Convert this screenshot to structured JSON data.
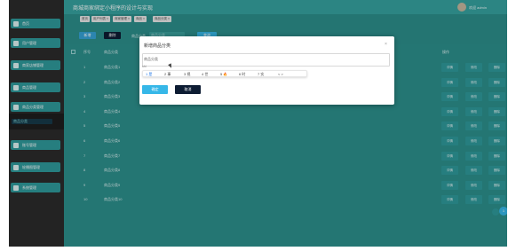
{
  "app": {
    "title": "商城商家绑定小程序的设计与实现",
    "user": "欢迎 admin",
    "colors": {
      "sidebar": "#2b2b2b",
      "main": "#2c8f8c",
      "accent": "#36b7e8",
      "button_dark": "#0d1c33"
    }
  },
  "tabs": [
    {
      "label": "首页"
    },
    {
      "label": "用户列表 ×"
    },
    {
      "label": "商家管理 ×"
    },
    {
      "label": "商品 ×"
    },
    {
      "label": "商品分类 ×"
    }
  ],
  "sidebar": {
    "items": [
      {
        "label": "首页"
      },
      {
        "label": "用户管理"
      },
      {
        "label": "商家店铺管理"
      },
      {
        "label": "商品管理"
      },
      {
        "label": "商品分类管理"
      },
      {
        "label": "账号管理"
      },
      {
        "label": "轮播图管理"
      },
      {
        "label": "系统管理"
      }
    ],
    "sub_item": "商品分类"
  },
  "toolbar": {
    "add_label": "新增",
    "delete_label": "删除",
    "filter_label": "商品分类",
    "filter_placeholder": "商品分类",
    "search_label": "查询"
  },
  "table": {
    "headers": [
      "序号",
      "商品分类",
      "操作"
    ],
    "rows": [
      {
        "num": "1",
        "name": "商品分类1"
      },
      {
        "num": "2",
        "name": "商品分类2"
      },
      {
        "num": "3",
        "name": "商品分类3"
      },
      {
        "num": "4",
        "name": "商品分类4"
      },
      {
        "num": "5",
        "name": "商品分类5"
      },
      {
        "num": "6",
        "name": "商品分类6"
      },
      {
        "num": "7",
        "name": "商品分类7"
      },
      {
        "num": "8",
        "name": "商品分类8"
      },
      {
        "num": "9",
        "name": "商品分类9"
      },
      {
        "num": "10",
        "name": "商品分类10"
      }
    ],
    "actions": [
      "详情",
      "修改",
      "删除"
    ]
  },
  "pager": {
    "current": "1"
  },
  "dialog": {
    "title": "新增商品分类",
    "close": "×",
    "field_label": "商品分类",
    "field_value": "商品分类",
    "hint": "shi",
    "candidates": [
      {
        "label": "1 是",
        "highlight": true
      },
      {
        "label": "2 事"
      },
      {
        "label": "3 视"
      },
      {
        "label": "4 世"
      },
      {
        "label": "5 🔥"
      },
      {
        "label": "6 时"
      },
      {
        "label": "7 实"
      },
      {
        "label": "< >"
      }
    ],
    "ok_label": "确定",
    "cancel_label": "取消"
  }
}
